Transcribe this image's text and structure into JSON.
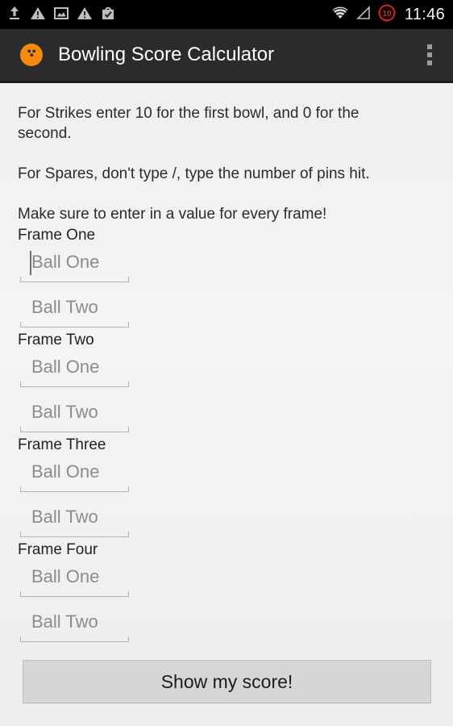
{
  "status_bar": {
    "icons": [
      {
        "name": "upload-icon"
      },
      {
        "name": "warning-icon"
      },
      {
        "name": "image-icon"
      },
      {
        "name": "warning-icon"
      },
      {
        "name": "play-store-icon"
      }
    ],
    "wifi_icon": "wifi-icon",
    "signal_icon": "signal-triangle-icon",
    "battery_icon": "battery-circle-icon",
    "battery_level": "10",
    "time": "11:46",
    "background_color": "#000000"
  },
  "app_bar": {
    "app_icon": "bowling-ball-icon",
    "icon_color": "#f58a11",
    "title": "Bowling Score Calculator",
    "overflow_icon": "overflow-menu-icon",
    "background_color": "#2b2b2b"
  },
  "instructions": {
    "line1": "For Strikes enter 10 for the first bowl, and 0 for the second.",
    "line2": "For Spares, don't type /, type the number of pins hit.",
    "line3": "Make sure to enter in a value for every frame!"
  },
  "frames": [
    {
      "label": "Frame One",
      "ball_one": {
        "placeholder": "Ball One",
        "value": "",
        "focused": true
      },
      "ball_two": {
        "placeholder": "Ball Two",
        "value": "",
        "focused": false
      }
    },
    {
      "label": "Frame Two",
      "ball_one": {
        "placeholder": "Ball One",
        "value": "",
        "focused": false
      },
      "ball_two": {
        "placeholder": "Ball Two",
        "value": "",
        "focused": false
      }
    },
    {
      "label": "Frame Three",
      "ball_one": {
        "placeholder": "Ball One",
        "value": "",
        "focused": false
      },
      "ball_two": {
        "placeholder": "Ball Two",
        "value": "",
        "focused": false
      }
    },
    {
      "label": "Frame Four",
      "ball_one": {
        "placeholder": "Ball One",
        "value": "",
        "focused": false
      },
      "ball_two": {
        "placeholder": "Ball Two",
        "value": "",
        "focused": false
      }
    }
  ],
  "submit_button": {
    "label": "Show my score!",
    "background_color": "#d6d6d6"
  }
}
